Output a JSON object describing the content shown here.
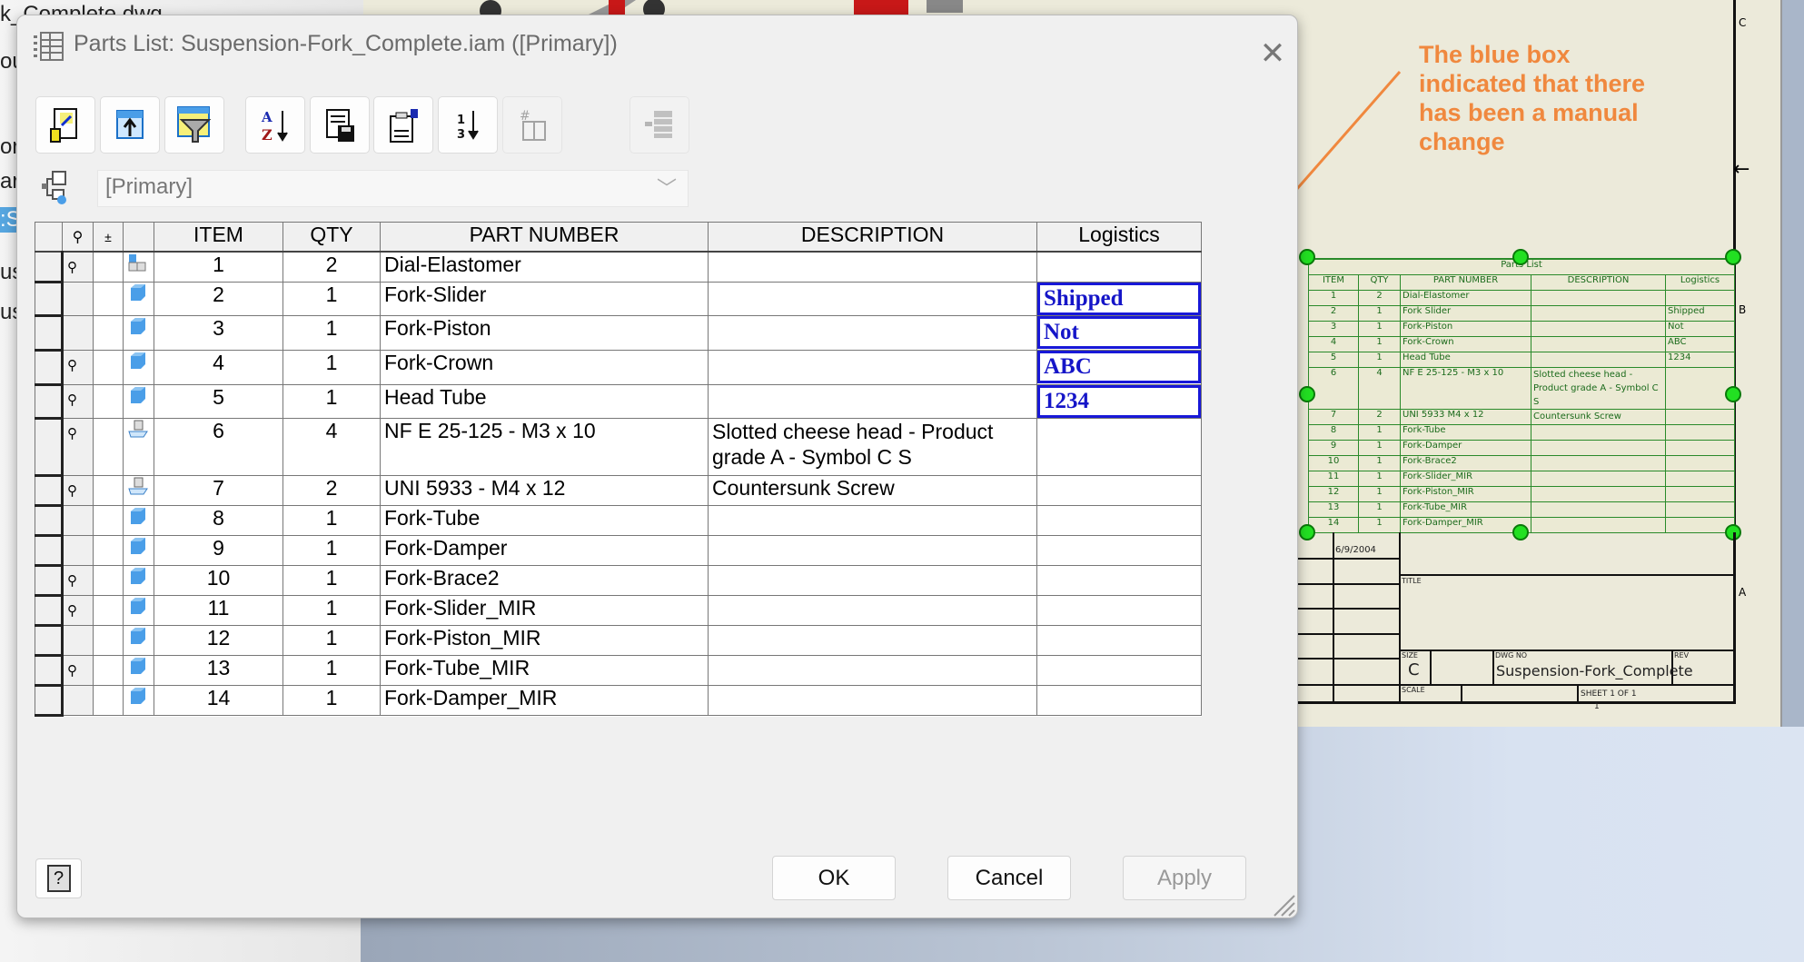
{
  "background": {
    "left_fragments": [
      "k_Complete.dwg",
      "ou",
      "or",
      "ar",
      ":S",
      "us",
      "us"
    ],
    "colors": {
      "selection": "#57a6e0",
      "sheet": "#eceada"
    }
  },
  "dialog": {
    "title": "Parts List: Suspension-Fork_Complete.iam ([Primary])",
    "close_label": "✕",
    "toolbar": [
      {
        "icon": "choose-items-icon",
        "tooltip": ""
      },
      {
        "icon": "insert-row-icon"
      },
      {
        "icon": "filter-icon"
      },
      {
        "icon": "sort-icon"
      },
      {
        "icon": "export-icon"
      },
      {
        "icon": "table-layout-icon"
      },
      {
        "icon": "renumber-icon"
      },
      {
        "icon": "part-number-merge-icon",
        "disabled": true
      },
      {
        "icon": "bom-icon",
        "disabled": true
      }
    ],
    "view": {
      "selected": "[Primary]"
    },
    "table": {
      "columns": [
        "",
        "",
        "",
        "",
        "ITEM",
        "QTY",
        "PART NUMBER",
        "DESCRIPTION",
        "Logistics"
      ],
      "rows": [
        {
          "balloon": true,
          "type": "assembly",
          "item": "1",
          "qty": "2",
          "part_number": "Dial-Elastomer",
          "description": "",
          "logistics": "",
          "override": false
        },
        {
          "balloon": false,
          "type": "part",
          "item": "2",
          "qty": "1",
          "part_number": "Fork-Slider",
          "description": "",
          "logistics": "Shipped",
          "override": true
        },
        {
          "balloon": false,
          "type": "part",
          "item": "3",
          "qty": "1",
          "part_number": "Fork-Piston",
          "description": "",
          "logistics": "Not",
          "override": true
        },
        {
          "balloon": true,
          "type": "part",
          "item": "4",
          "qty": "1",
          "part_number": "Fork-Crown",
          "description": "",
          "logistics": "ABC",
          "override": true
        },
        {
          "balloon": true,
          "type": "part",
          "item": "5",
          "qty": "1",
          "part_number": "Head Tube",
          "description": "",
          "logistics": "1234",
          "override": true
        },
        {
          "balloon": true,
          "type": "standard",
          "item": "6",
          "qty": "4",
          "part_number": "NF E 25-125 - M3 x 10",
          "description": "Slotted cheese head - Product grade A - Symbol C S",
          "description_lines": [
            "Slotted cheese head - Product",
            "grade A - Symbol C S"
          ],
          "logistics": "",
          "override": false
        },
        {
          "balloon": true,
          "type": "standard",
          "item": "7",
          "qty": "2",
          "part_number": "UNI 5933 - M4 x 12",
          "description": "Countersunk Screw",
          "logistics": "",
          "override": false
        },
        {
          "balloon": false,
          "type": "part",
          "item": "8",
          "qty": "1",
          "part_number": "Fork-Tube",
          "description": "",
          "logistics": "",
          "override": false
        },
        {
          "balloon": false,
          "type": "part",
          "item": "9",
          "qty": "1",
          "part_number": "Fork-Damper",
          "description": "",
          "logistics": "",
          "override": false
        },
        {
          "balloon": true,
          "type": "part",
          "item": "10",
          "qty": "1",
          "part_number": "Fork-Brace2",
          "description": "",
          "logistics": "",
          "override": false
        },
        {
          "balloon": true,
          "type": "part",
          "item": "11",
          "qty": "1",
          "part_number": "Fork-Slider_MIR",
          "description": "",
          "logistics": "",
          "override": false
        },
        {
          "balloon": false,
          "type": "part",
          "item": "12",
          "qty": "1",
          "part_number": "Fork-Piston_MIR",
          "description": "",
          "logistics": "",
          "override": false
        },
        {
          "balloon": true,
          "type": "part",
          "item": "13",
          "qty": "1",
          "part_number": "Fork-Tube_MIR",
          "description": "",
          "logistics": "",
          "override": false
        },
        {
          "balloon": false,
          "type": "part",
          "item": "14",
          "qty": "1",
          "part_number": "Fork-Damper_MIR",
          "description": "",
          "logistics": "",
          "override": false
        }
      ],
      "override_color": "#1818d8"
    },
    "buttons": {
      "help": "?",
      "ok": "OK",
      "cancel": "Cancel",
      "apply": "Apply"
    }
  },
  "annotation": {
    "lines": [
      "The blue box",
      "indicated that there",
      "has been a manual",
      "change"
    ],
    "color": "#f0883e"
  },
  "drawing": {
    "parts_list_title": "Parts List",
    "columns": [
      "ITEM",
      "QTY",
      "PART NUMBER",
      "DESCRIPTION",
      "Logistics"
    ],
    "rows": [
      [
        "1",
        "2",
        "Dial-Elastomer",
        "",
        ""
      ],
      [
        "2",
        "1",
        "Fork Slider",
        "",
        "Shipped"
      ],
      [
        "3",
        "1",
        "Fork-Piston",
        "",
        "Not"
      ],
      [
        "4",
        "1",
        "Fork-Crown",
        "",
        "ABC"
      ],
      [
        "5",
        "1",
        "Head Tube",
        "",
        "1234"
      ],
      [
        "6",
        "4",
        "NF E 25-125 - M3 x 10",
        "Slotted cheese head - Product grade A - Symbol C S",
        ""
      ],
      [
        "7",
        "2",
        "UNI 5933   M4 x 12",
        "Countersunk Screw",
        ""
      ],
      [
        "8",
        "1",
        "Fork-Tube",
        "",
        ""
      ],
      [
        "9",
        "1",
        "Fork-Damper",
        "",
        ""
      ],
      [
        "10",
        "1",
        "Fork-Brace2",
        "",
        ""
      ],
      [
        "11",
        "1",
        "Fork-Slider_MIR",
        "",
        ""
      ],
      [
        "12",
        "1",
        "Fork-Piston_MIR",
        "",
        ""
      ],
      [
        "13",
        "1",
        "Fork-Tube_MIR",
        "",
        ""
      ],
      [
        "14",
        "1",
        "Fork-Damper_MIR",
        "",
        ""
      ]
    ],
    "title_block": {
      "date": "6/9/2004",
      "title_label": "TITLE",
      "size_label": "SIZE",
      "size": "C",
      "dwg_no_label": "DWG NO",
      "dwg_no": "Suspension-Fork_Complete",
      "rev_label": "REV",
      "scale_label": "SCALE",
      "sheet": "SHEET 1  OF 1",
      "zone_bottom": "1"
    },
    "zone_labels": [
      "C",
      "B",
      "A"
    ]
  }
}
